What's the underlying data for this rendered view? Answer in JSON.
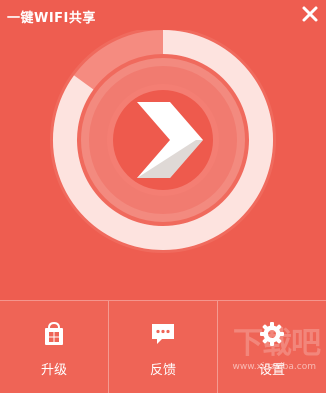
{
  "window": {
    "title": "一键WIFI共享",
    "close_icon": "close-icon"
  },
  "main": {
    "ring_progress_percent": 85,
    "start_icon": "chevron-right-icon"
  },
  "toolbar": {
    "items": [
      {
        "label": "升级",
        "icon": "store-icon"
      },
      {
        "label": "反馈",
        "icon": "chat-bubble-icon"
      },
      {
        "label": "设置",
        "icon": "gear-icon"
      }
    ]
  },
  "watermark": {
    "text": "下载吧",
    "url": "www.xiazaiba.com"
  },
  "colors": {
    "background": "#ee5d50",
    "ring_track": "#f58b80",
    "ring_fill": "#fde3df",
    "inner_disc": "#ee5a4d",
    "arrow": "#ffffff"
  }
}
